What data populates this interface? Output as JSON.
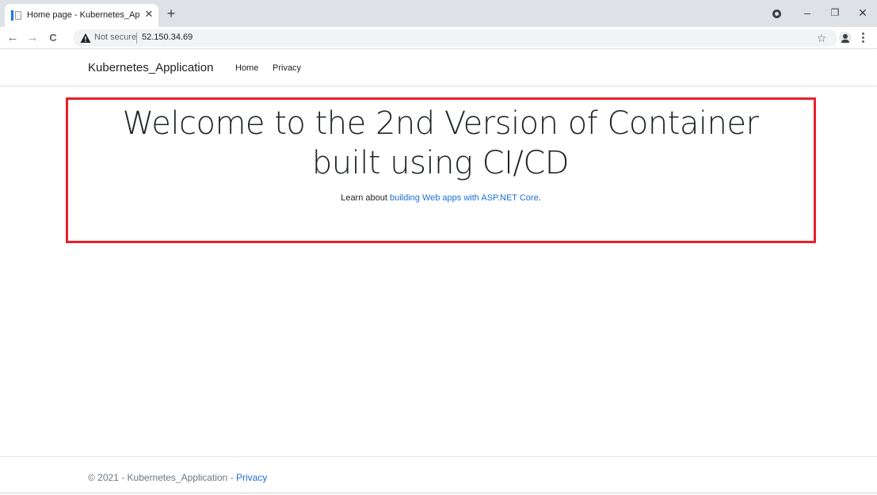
{
  "browser": {
    "tab_title": "Home page - Kubernetes_Applic",
    "tab_close_glyph": "✕",
    "new_tab_glyph": "+",
    "back_glyph": "←",
    "forward_glyph": "→",
    "reload_glyph": "C",
    "security_label": "Not secure",
    "url": "52.150.34.69",
    "bookmark_glyph": "☆",
    "minimize_glyph": "–",
    "restore_glyph": "❐",
    "close_glyph": "✕",
    "icons": [
      "page-favicon-icon",
      "close-icon",
      "plus-icon",
      "profile-icon",
      "minimize-icon",
      "restore-icon",
      "window-close-icon",
      "back-arrow-icon",
      "forward-arrow-icon",
      "reload-icon",
      "warning-icon",
      "star-icon",
      "account-icon",
      "kebab-menu-icon"
    ]
  },
  "site": {
    "brand": "Kubernetes_Application",
    "nav": [
      "Home",
      "Privacy"
    ]
  },
  "main": {
    "title": "Welcome to the 2nd Version of Container built using CI/CD",
    "lead_prefix": "Learn about",
    "lead_link": "building Web apps with ASP.NET Core",
    "lead_suffix": ".",
    "highlight_color": "#e8202a"
  },
  "footer": {
    "text": "© 2021 - Kubernetes_Application -",
    "link": "Privacy"
  },
  "colors": {
    "link": "#1a6fd6",
    "tabstrip": "#dee1e6",
    "omnibox": "#f1f3f4"
  }
}
